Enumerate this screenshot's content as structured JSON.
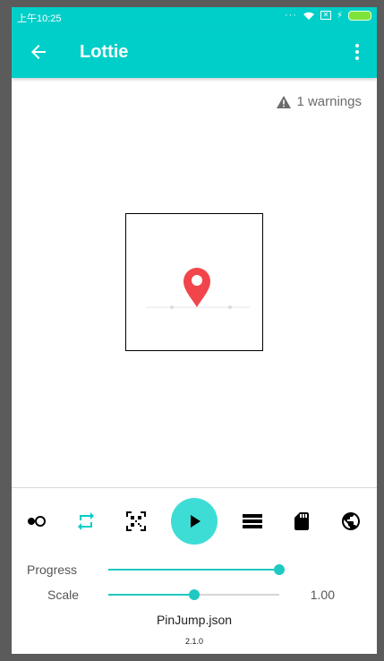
{
  "status_bar": {
    "time": "上午10:25",
    "indicators": [
      "dots-icon",
      "wifi-icon",
      "no-sim-icon",
      "charging-icon",
      "battery-icon"
    ]
  },
  "app_bar": {
    "title": "Lottie",
    "back_icon": "arrow-back-icon",
    "menu_icon": "more-vert-icon"
  },
  "warnings": {
    "text": "1 warnings",
    "icon": "warning-icon"
  },
  "controls": {
    "buttons": [
      {
        "name": "background-color-button",
        "icon": "dot-circle-icon"
      },
      {
        "name": "loop-button",
        "icon": "repeat-icon"
      },
      {
        "name": "qr-scan-button",
        "icon": "qr-code-icon"
      },
      {
        "name": "play-button",
        "icon": "play-icon"
      },
      {
        "name": "list-button",
        "icon": "list-icon"
      },
      {
        "name": "sd-card-button",
        "icon": "sd-card-icon"
      },
      {
        "name": "network-button",
        "icon": "globe-icon"
      }
    ],
    "accent_color": "#00cec8"
  },
  "sliders": {
    "progress": {
      "label": "Progress",
      "value": 1.0
    },
    "scale": {
      "label": "Scale",
      "value": 0.5,
      "display": "1.00"
    }
  },
  "file": {
    "name": "PinJump.json",
    "version": "2.1.0"
  },
  "colors": {
    "primary": "#00cec8",
    "play_button": "#3dddd6",
    "pin": "#f2454b"
  }
}
